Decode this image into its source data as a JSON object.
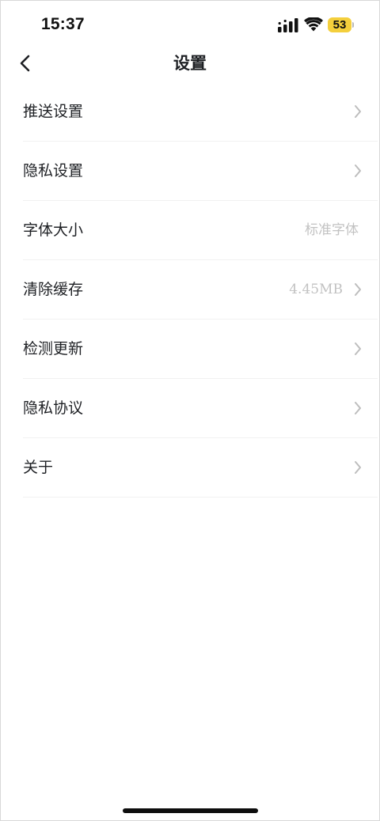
{
  "status_bar": {
    "time": "15:37",
    "battery_level": "53",
    "icons": [
      "cellular-signal-icon",
      "wifi-icon",
      "battery-icon"
    ],
    "battery_color": "#f4cf3c"
  },
  "nav": {
    "title": "设置",
    "back_icon": "chevron-left-icon"
  },
  "settings": {
    "items": [
      {
        "label": "推送设置",
        "value": "",
        "chevron": true
      },
      {
        "label": "隐私设置",
        "value": "",
        "chevron": true
      },
      {
        "label": "字体大小",
        "value": "标准字体",
        "chevron": false
      },
      {
        "label": "清除缓存",
        "value": "4.45MB",
        "chevron": true
      },
      {
        "label": "检测更新",
        "value": "",
        "chevron": true
      },
      {
        "label": "隐私协议",
        "value": "",
        "chevron": true
      },
      {
        "label": "关于",
        "value": "",
        "chevron": true
      }
    ]
  },
  "colors": {
    "text_primary": "#1e2024",
    "text_secondary": "#c2c2c2",
    "chevron": "#bdbdbd",
    "divider": "#f1f1f1",
    "background": "#ffffff"
  }
}
